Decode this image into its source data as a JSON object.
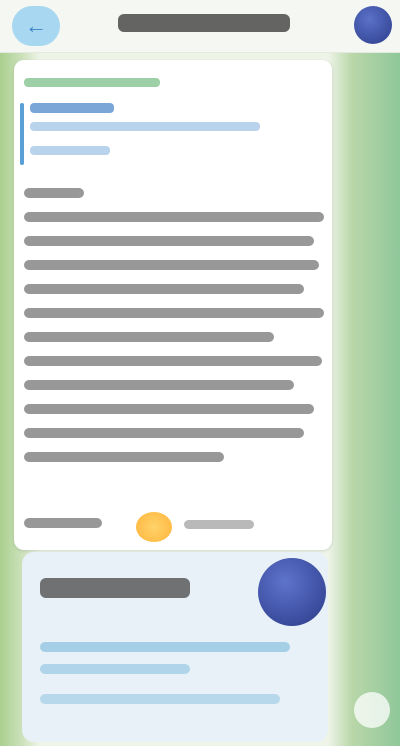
{
  "header": {
    "back_icon": "back-icon",
    "avatar_icon": "channel-avatar"
  },
  "message": {
    "text_lines": 12
  }
}
